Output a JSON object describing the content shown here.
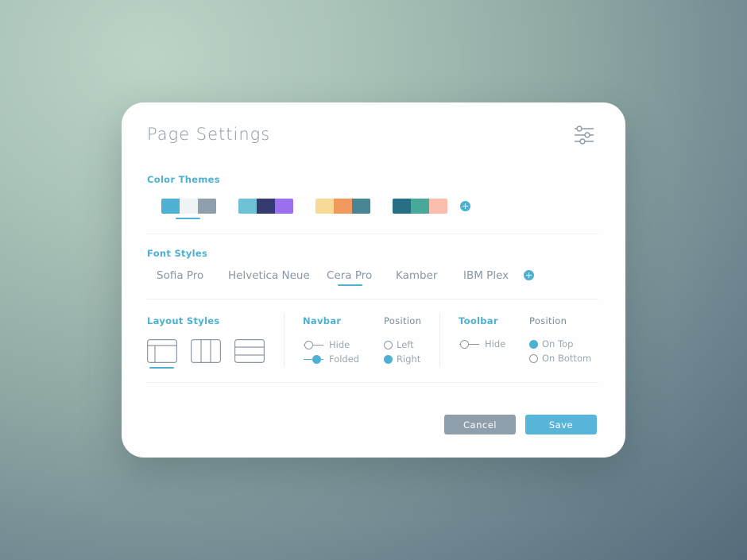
{
  "dialog": {
    "title": "Page Settings",
    "settings_icon": "sliders-icon"
  },
  "color_themes": {
    "label": "Color Themes",
    "selected_index": 0,
    "swatches": [
      [
        "#4fb1d4",
        "#eef3f6",
        "#8f9eab"
      ],
      [
        "#6dc3d5",
        "#343b6e",
        "#9a6ff0"
      ],
      [
        "#f7da95",
        "#f29a5e",
        "#4a8593"
      ],
      [
        "#266f84",
        "#48a999",
        "#fbbeae"
      ]
    ]
  },
  "font_styles": {
    "label": "Font Styles",
    "selected_index": 2,
    "items": [
      "Sofia Pro",
      "Helvetica Neue",
      "Cera Pro",
      "Kamber",
      "IBM Plex"
    ]
  },
  "layout_styles": {
    "label": "Layout Styles",
    "selected_index": 0
  },
  "navbar": {
    "label": "Navbar",
    "position_label": "Position",
    "toggles": [
      {
        "label": "Hide",
        "on": false
      },
      {
        "label": "Folded",
        "on": true
      }
    ],
    "positions": [
      {
        "label": "Left",
        "on": false
      },
      {
        "label": "Right",
        "on": true
      }
    ]
  },
  "toolbar": {
    "label": "Toolbar",
    "position_label": "Position",
    "toggles": [
      {
        "label": "Hide",
        "on": false
      }
    ],
    "positions": [
      {
        "label": "On Top",
        "on": true
      },
      {
        "label": "On Bottom",
        "on": false
      }
    ]
  },
  "actions": {
    "cancel_label": "Cancel",
    "save_label": "Save"
  },
  "colors": {
    "accent": "#4eb0d2",
    "muted": "#8f9eab"
  }
}
